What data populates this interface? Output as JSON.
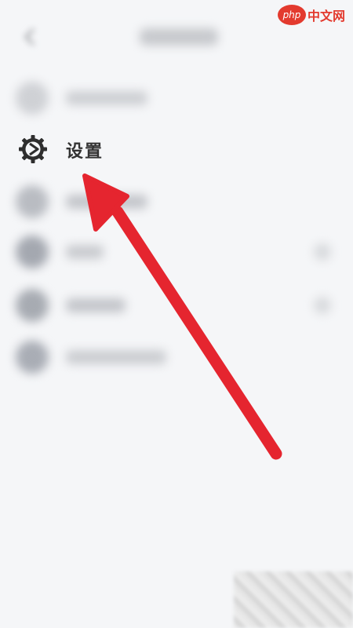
{
  "watermark": {
    "logo_mark": "php",
    "logo_text": "中文网"
  },
  "menu": {
    "settings": {
      "label": "设置",
      "icon": "gear-icon"
    }
  },
  "annotation": {
    "type": "arrow",
    "color": "#e5252f",
    "points_to": "settings"
  },
  "colors": {
    "background": "#f5f6f8",
    "blurred_shape": "#c7c9cd",
    "arrow_red": "#e5252f",
    "label_dark": "#333333"
  }
}
